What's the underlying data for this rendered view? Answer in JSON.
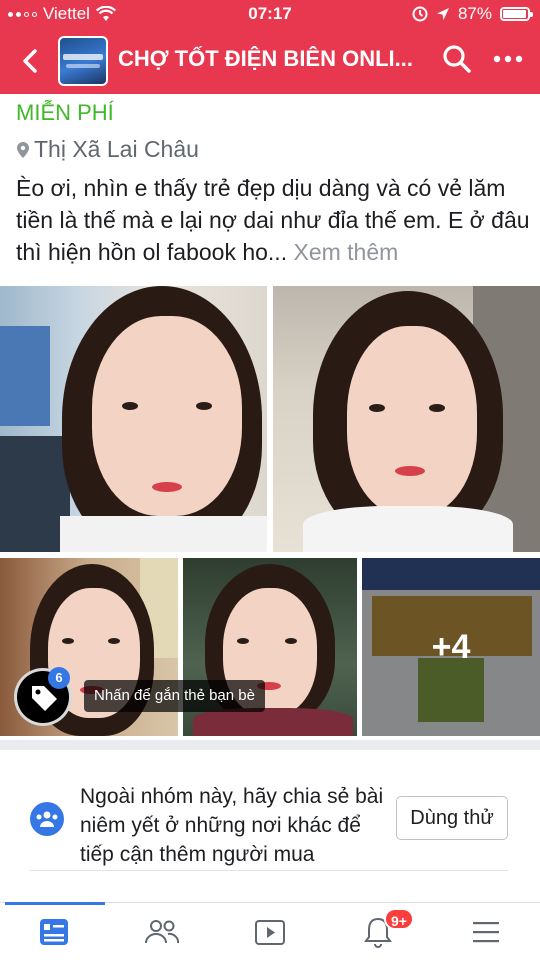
{
  "status_bar": {
    "carrier": "Viettel",
    "time": "07:17",
    "battery_percent": "87%",
    "battery_level": 0.87,
    "icons": [
      "wifi-icon",
      "alarm-icon",
      "location-arrow-icon",
      "battery-icon"
    ]
  },
  "header": {
    "back_icon": "chevron-left-icon",
    "group_title": "CHỢ TỐT ĐIỆN BIÊN ONLI...",
    "search_icon": "search-icon",
    "more_icon": "more-dots-icon",
    "background_color": "#e8384f"
  },
  "post": {
    "price": "MIỄN PHÍ",
    "price_color": "#42b72a",
    "location": "Thị Xã Lai Châu",
    "body": "Èo ơi, nhìn e thấy trẻ đẹp dịu dàng và có vẻ lăm tiền là thế mà e lại nợ dai như đỉa thế em. E ở đâu thì hiện hồn ol fabook ho...",
    "see_more": "Xem thêm",
    "photos": {
      "extra_count": "+4",
      "tag_count": "6",
      "tag_hint": "Nhấn để gắn thẻ bạn bè"
    }
  },
  "suggestion": {
    "text": "Ngoài nhóm này, hãy chia sẻ bài niêm yết ở những nơi khác để tiếp cận thêm người mua",
    "button": "Dùng thử",
    "icon": "group-people-icon"
  },
  "bottom_nav": {
    "items": [
      "news-feed-icon",
      "friends-icon",
      "watch-video-icon",
      "notifications-bell-icon",
      "menu-hamburger-icon"
    ],
    "active_index": 0,
    "notification_badge": "9+",
    "accent_color": "#3578e5"
  }
}
